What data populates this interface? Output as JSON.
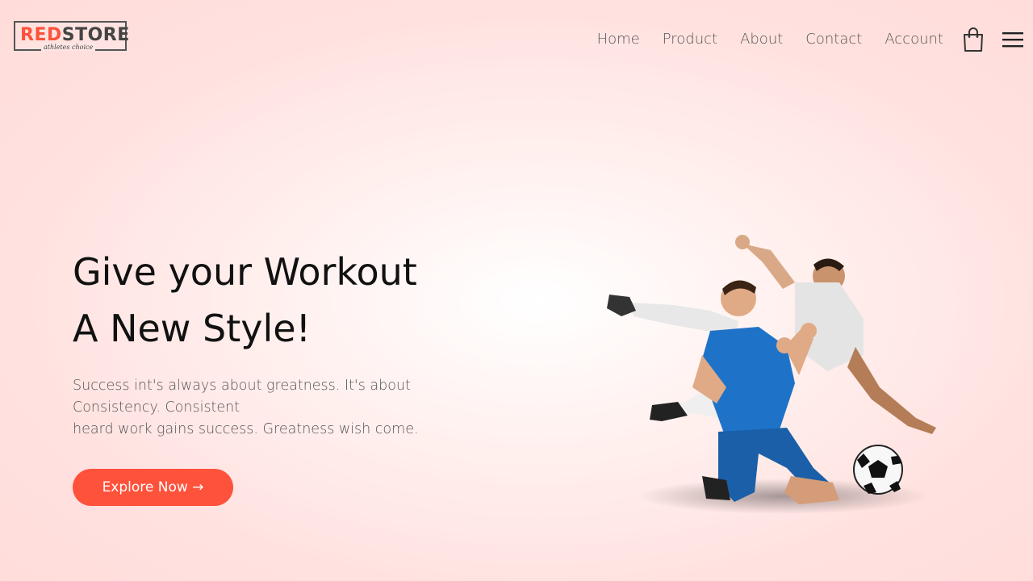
{
  "brand": {
    "logo_part1": "RED",
    "logo_part2": "STORE",
    "tagline": "athletes choice",
    "accent_color": "#ff523b"
  },
  "nav": {
    "items": [
      {
        "label": "Home"
      },
      {
        "label": "Product"
      },
      {
        "label": "About"
      },
      {
        "label": "Contact"
      },
      {
        "label": "Account"
      }
    ],
    "cart_icon": "shopping-bag-icon",
    "menu_icon": "hamburger-menu-icon"
  },
  "hero": {
    "title_line1": "Give your Workout",
    "title_line2": "A New Style!",
    "desc_line1": "Success int's always about greatness. It's about",
    "desc_line2": "Consistency. Consistent",
    "desc_line3": "heard work gains success. Greatness wish come.",
    "button_label": "Explore Now →",
    "image_subject": "football-players-image"
  }
}
